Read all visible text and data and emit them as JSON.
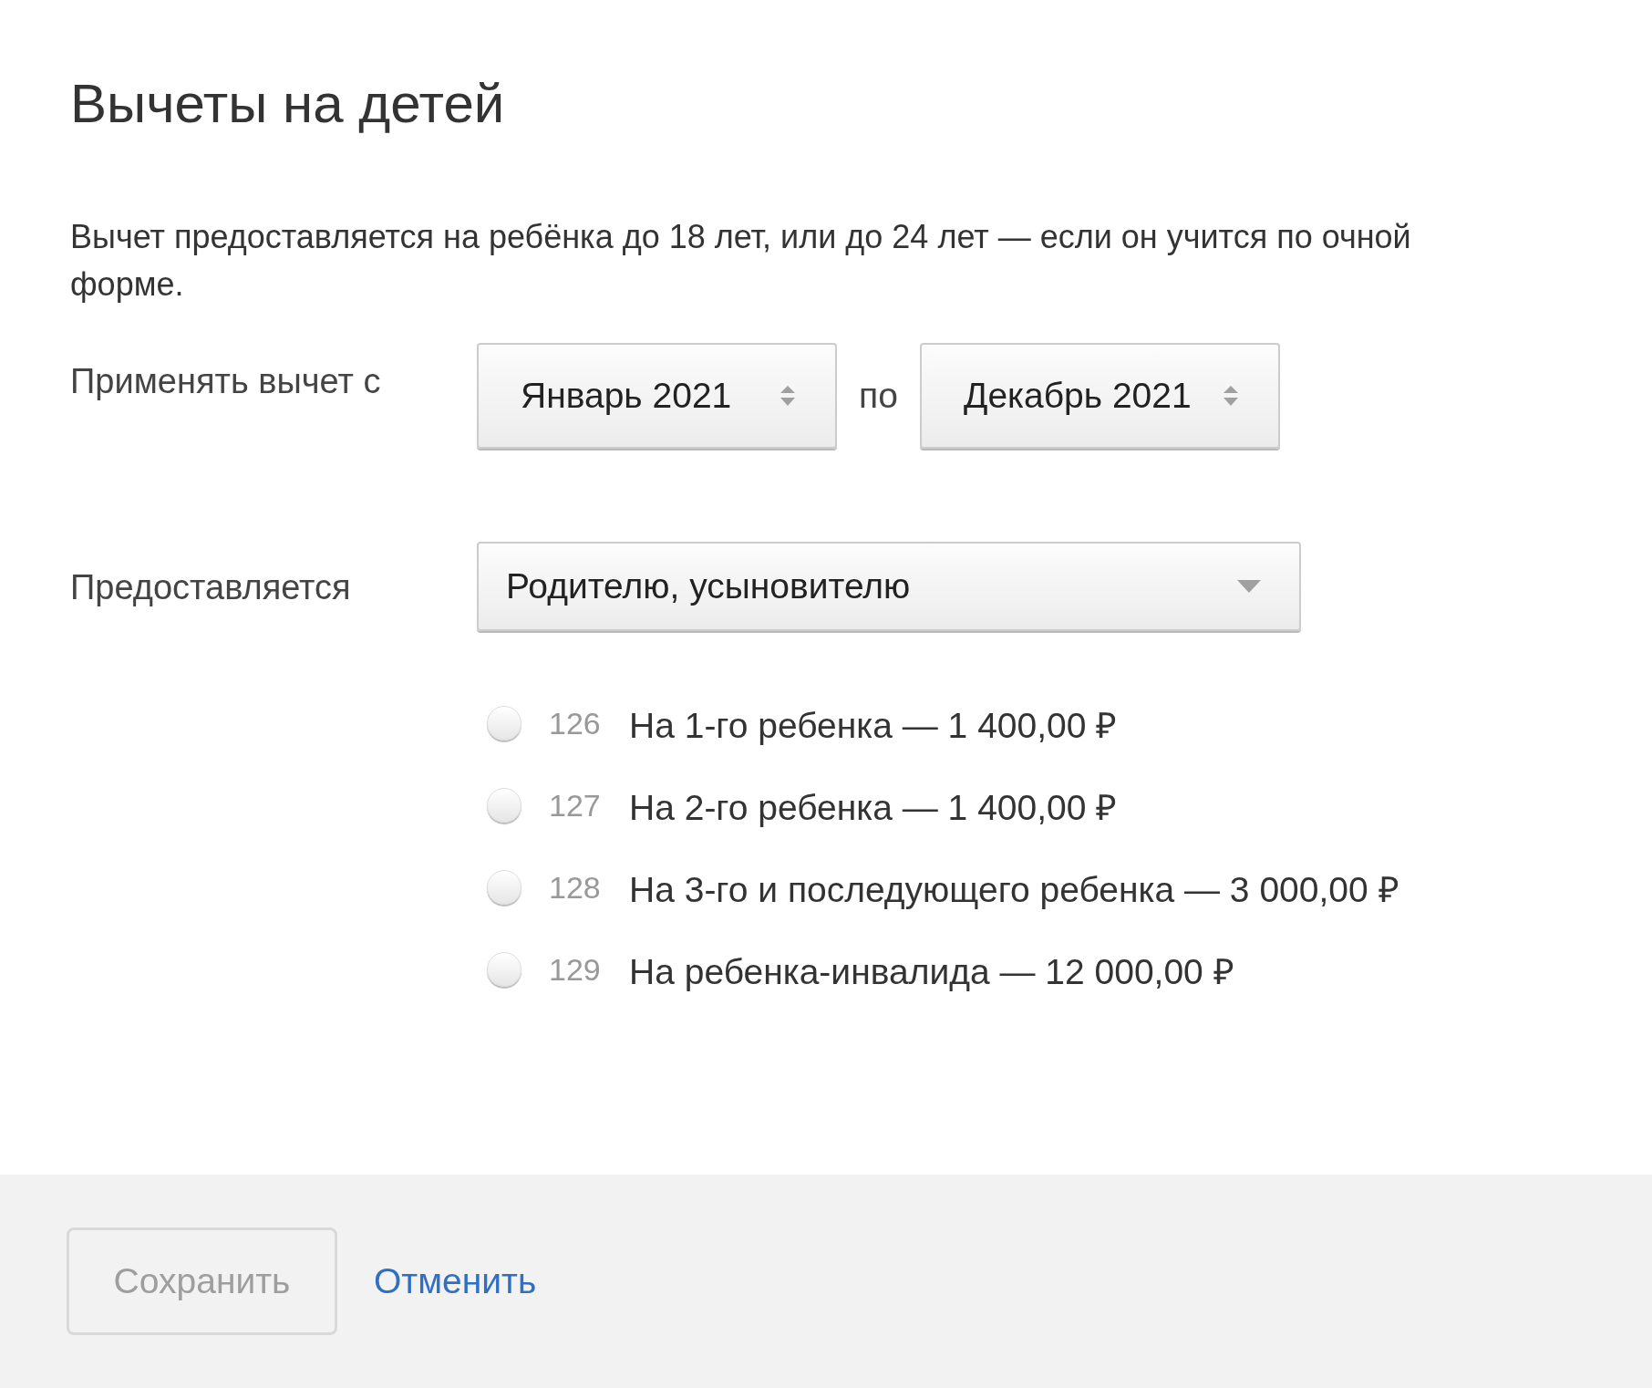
{
  "title": "Вычеты на детей",
  "description": "Вычет предоставляется на ребёнка до 18 лет, или до 24 лет — если он учится по очной форме.",
  "period": {
    "label": "Применять вычет с",
    "from": {
      "value": "Январь 2021"
    },
    "separator": "по",
    "to": {
      "value": "Декабрь 2021"
    }
  },
  "recipient": {
    "label": "Предоставляется",
    "value": "Родителю, усыновителю"
  },
  "options": [
    {
      "code": "126",
      "label": "На 1-го ребенка — 1 400,00 ₽",
      "selected": false
    },
    {
      "code": "127",
      "label": "На 2-го ребенка — 1 400,00 ₽",
      "selected": false
    },
    {
      "code": "128",
      "label": "На 3-го и последующего ребенка — 3 000,00 ₽",
      "selected": false
    },
    {
      "code": "129",
      "label": "На ребенка-инвалида — 12 000,00 ₽",
      "selected": false
    }
  ],
  "footer": {
    "save": {
      "label": "Сохранить",
      "disabled": true
    },
    "cancel": {
      "label": "Отменить"
    }
  }
}
